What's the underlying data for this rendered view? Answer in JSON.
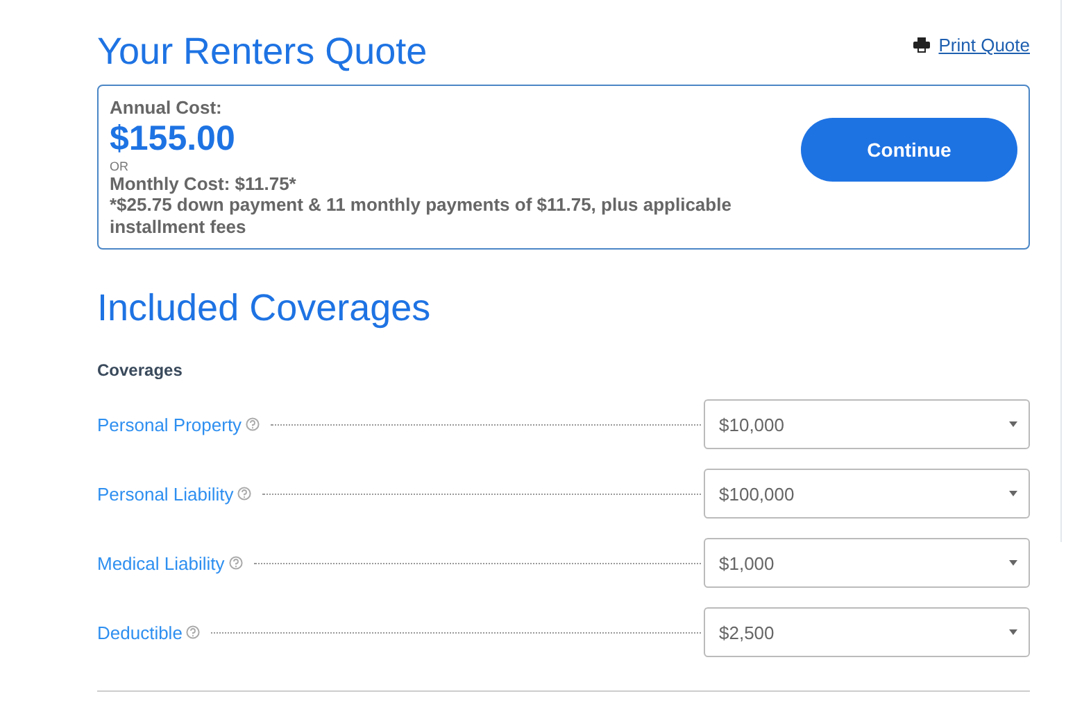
{
  "quote": {
    "title": "Your Renters Quote",
    "print_link": "Print Quote",
    "annual_label": "Annual Cost:",
    "annual_amount": "$155.00",
    "or": "OR",
    "monthly": "Monthly Cost: $11.75*",
    "footnote": "*$25.75 down payment & 11 monthly payments of $11.75, plus applicable installment fees",
    "continue_button": "Continue"
  },
  "coverages": {
    "title": "Included Coverages",
    "subtitle": "Coverages",
    "rows": [
      {
        "label": "Personal Property",
        "value": "$10,000"
      },
      {
        "label": "Personal Liability",
        "value": "$100,000"
      },
      {
        "label": "Medical Liability",
        "value": "$1,000"
      },
      {
        "label": "Deductible",
        "value": "$2,500"
      }
    ]
  }
}
